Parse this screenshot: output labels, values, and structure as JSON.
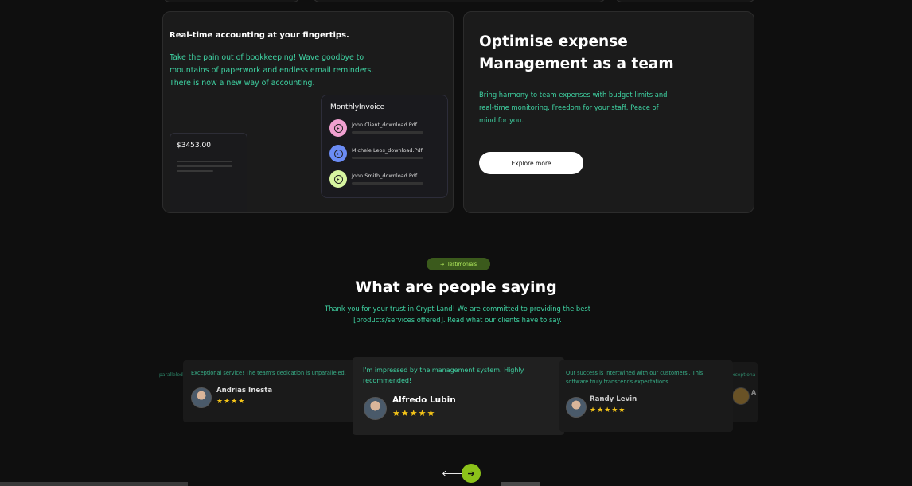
{
  "accounting_card": {
    "title": "Real-time accounting at your fingertips.",
    "description": "Take the pain out of bookkeeping! Wave goodbye to mountains of paperwork and endless email reminders. There is now a new way of accounting.",
    "amount": "$3453.00",
    "invoice": {
      "title": "MonthlyInvoice",
      "items": [
        {
          "name": "John Client_download.Pdf",
          "icon": "file-icon",
          "color": "#f0a0d0"
        },
        {
          "name": "Michele Leos_download.Pdf",
          "icon": "file-icon",
          "color": "#6b8cf5"
        },
        {
          "name": "John Smith_download.Pdf",
          "icon": "file-icon",
          "color": "#d7f5a0"
        }
      ]
    }
  },
  "expense_card": {
    "title": "Optimise expense Management as a team",
    "description": "Bring harmony to team expenses with budget limits and real-time monitoring. Freedom for your staff. Peace of mind for you.",
    "button_label": "Explore more"
  },
  "testimonials": {
    "badge_label": "Testimonials",
    "badge_icon": "arrow-right-icon",
    "heading": "What are people saying",
    "subheading": "Thank you for your trust in Crypt Land! We are committed to providing the best [products/services offered]. Read what our clients have to say.",
    "cards": [
      {
        "quote": "Exceptional service! The team's dedication is unparalleled.",
        "name": "Andrias Inesta",
        "stars": "★★★★"
      },
      {
        "quote": "I'm impressed by the management system. Highly recommended!",
        "name": "Alfredo Lubin",
        "stars": "★★★★★"
      },
      {
        "quote": "Our success is intertwined with our customers'. This software truly transcends expectations.",
        "name": "Randy Levin",
        "stars": "★★★★★"
      }
    ],
    "partial_left": "paralleled.",
    "partial_right": "xceptiona",
    "partial_right_name": "A"
  },
  "carousel": {
    "prev_icon": "arrow-left-icon",
    "next_icon": "arrow-right-icon",
    "prev_glyph": "🡐",
    "next_glyph": "➔"
  },
  "colors": {
    "accent_green": "#3fd3a3",
    "lime": "#8cc21a",
    "badge_bg": "#3b5a1c",
    "star": "#f5c518"
  }
}
